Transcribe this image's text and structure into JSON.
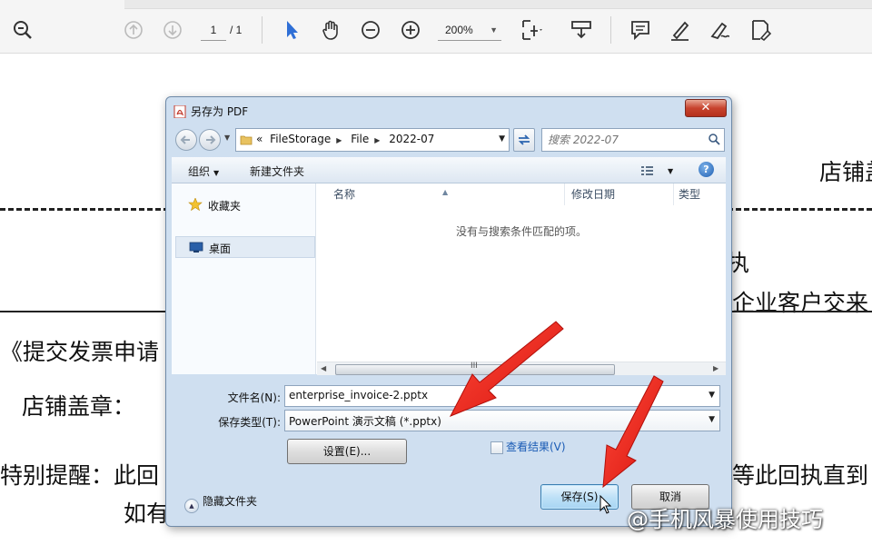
{
  "toolbar": {
    "page_current": "1",
    "page_total": "/ 1",
    "zoom": "200%"
  },
  "document": {
    "line_store_top": "店铺盖",
    "line_zhi": "执",
    "line_enterprise": "企业客户交来",
    "line_submit": "《提交发票申请",
    "line_stamp": "店铺盖章：",
    "line_reminder_left": "特别提醒：此回",
    "line_reminder_right": "等此回执直到",
    "line_if": "如有"
  },
  "dialog": {
    "title": "另存为 PDF",
    "close_label": "✕",
    "address": {
      "prefix": "«",
      "crumbs": [
        "FileStorage",
        "File",
        "2022-07"
      ]
    },
    "search_placeholder": "搜索 2022-07",
    "commands": {
      "organize": "组织",
      "new_folder": "新建文件夹",
      "help": "?"
    },
    "nav": {
      "favorites": "收藏夹",
      "desktop": "桌面"
    },
    "columns": {
      "name": "名称",
      "modified": "修改日期",
      "type": "类型"
    },
    "empty_message": "没有与搜索条件匹配的项。",
    "scroll_grip": "III",
    "filename_label": "文件名(N):",
    "filename_value": "enterprise_invoice-2.pptx",
    "filetype_label": "保存类型(T):",
    "filetype_value": "PowerPoint 演示文稿 (*.pptx)",
    "settings_button": "设置(E)...",
    "view_results": "查看结果(V)",
    "hide_folders": "隐藏文件夹",
    "save_button": "保存(S)",
    "cancel_button": "取消"
  },
  "watermark": "@手机风暴使用技巧",
  "colors": {
    "arrow": "#e8201c",
    "tool_blue": "#2f6fd6",
    "dialog_frame": "#cfdff0"
  }
}
